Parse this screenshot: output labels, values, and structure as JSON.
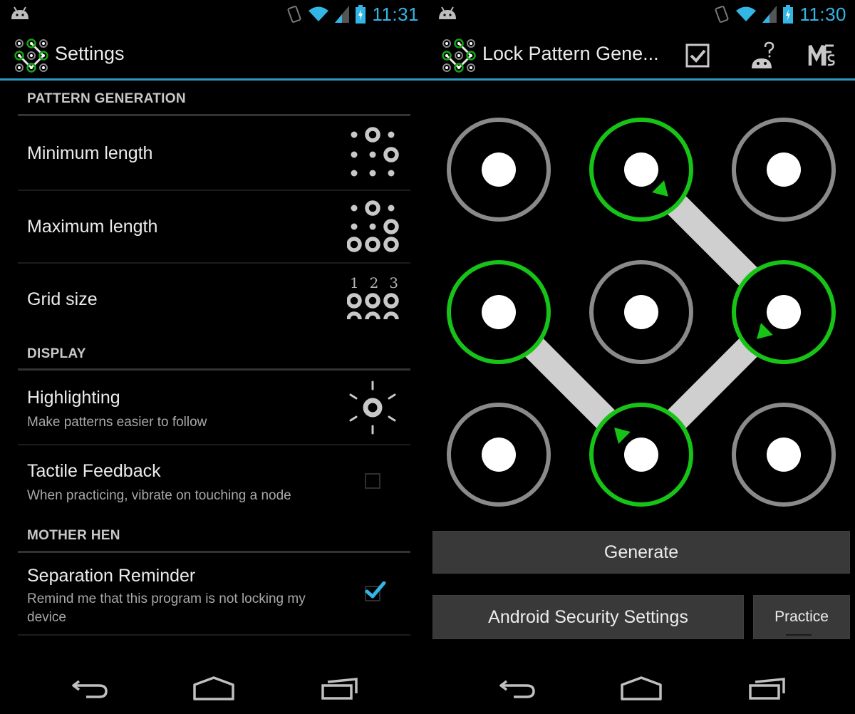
{
  "left_screen": {
    "status_bar": {
      "time": "11:31",
      "icons": [
        "android-notification-icon",
        "rotation-lock-icon",
        "wifi-icon",
        "signal-icon",
        "battery-charging-icon"
      ]
    },
    "action_bar": {
      "title": "Settings",
      "icon": "lock-pattern-app-icon"
    },
    "sections": [
      {
        "header": "PATTERN GENERATION",
        "items": [
          {
            "title": "Minimum length",
            "widget": "min-length-pattern-icon"
          },
          {
            "title": "Maximum length",
            "widget": "max-length-pattern-icon"
          },
          {
            "title": "Grid size",
            "widget": "grid-size-icon",
            "grid_labels": [
              "1",
              "2",
              "3"
            ]
          }
        ]
      },
      {
        "header": "DISPLAY",
        "items": [
          {
            "title": "Highlighting",
            "summary": "Make patterns easier to follow",
            "widget": "brightness-icon"
          },
          {
            "title": "Tactile Feedback",
            "summary": "When practicing, vibrate on touching a node",
            "widget": "checkbox",
            "checked": false
          }
        ]
      },
      {
        "header": "MOTHER HEN",
        "items": [
          {
            "title": "Separation Reminder",
            "summary": "Remind me that this program is not locking my device",
            "widget": "checkbox",
            "checked": true
          }
        ]
      }
    ],
    "nav_bar": [
      "back-icon",
      "home-icon",
      "recent-apps-icon"
    ]
  },
  "right_screen": {
    "status_bar": {
      "time": "11:30",
      "icons": [
        "android-notification-icon",
        "rotation-lock-icon",
        "wifi-icon",
        "signal-icon",
        "battery-charging-icon"
      ]
    },
    "action_bar": {
      "title": "Lock Pattern Gene...",
      "icon": "lock-pattern-app-icon",
      "actions": [
        "checkbox-action-icon",
        "android-help-icon",
        "mfs-icon"
      ]
    },
    "pattern": {
      "grid_size": 3,
      "sequence": [
        [
          1,
          0
        ],
        [
          0,
          1
        ],
        [
          1,
          2
        ],
        [
          2,
          1
        ],
        [
          1,
          0
        ]
      ],
      "note": "row,col order of path: top-middle → middle-right → bottom-middle → middle-left",
      "path": [
        [
          0,
          1
        ],
        [
          1,
          2
        ],
        [
          2,
          1
        ],
        [
          1,
          0
        ]
      ],
      "active_color": "#16c316",
      "inactive_color": "#8a8a8a",
      "line_color": "#cfcfcf"
    },
    "buttons": {
      "generate": "Generate",
      "android_security": "Android Security Settings",
      "practice": "Practice"
    },
    "nav_bar": [
      "back-icon",
      "home-icon",
      "recent-apps-icon"
    ]
  },
  "colors": {
    "accent": "#33b5e5",
    "checkbox_check": "#33b5e5",
    "background": "#000000",
    "button_bg": "#393939"
  }
}
